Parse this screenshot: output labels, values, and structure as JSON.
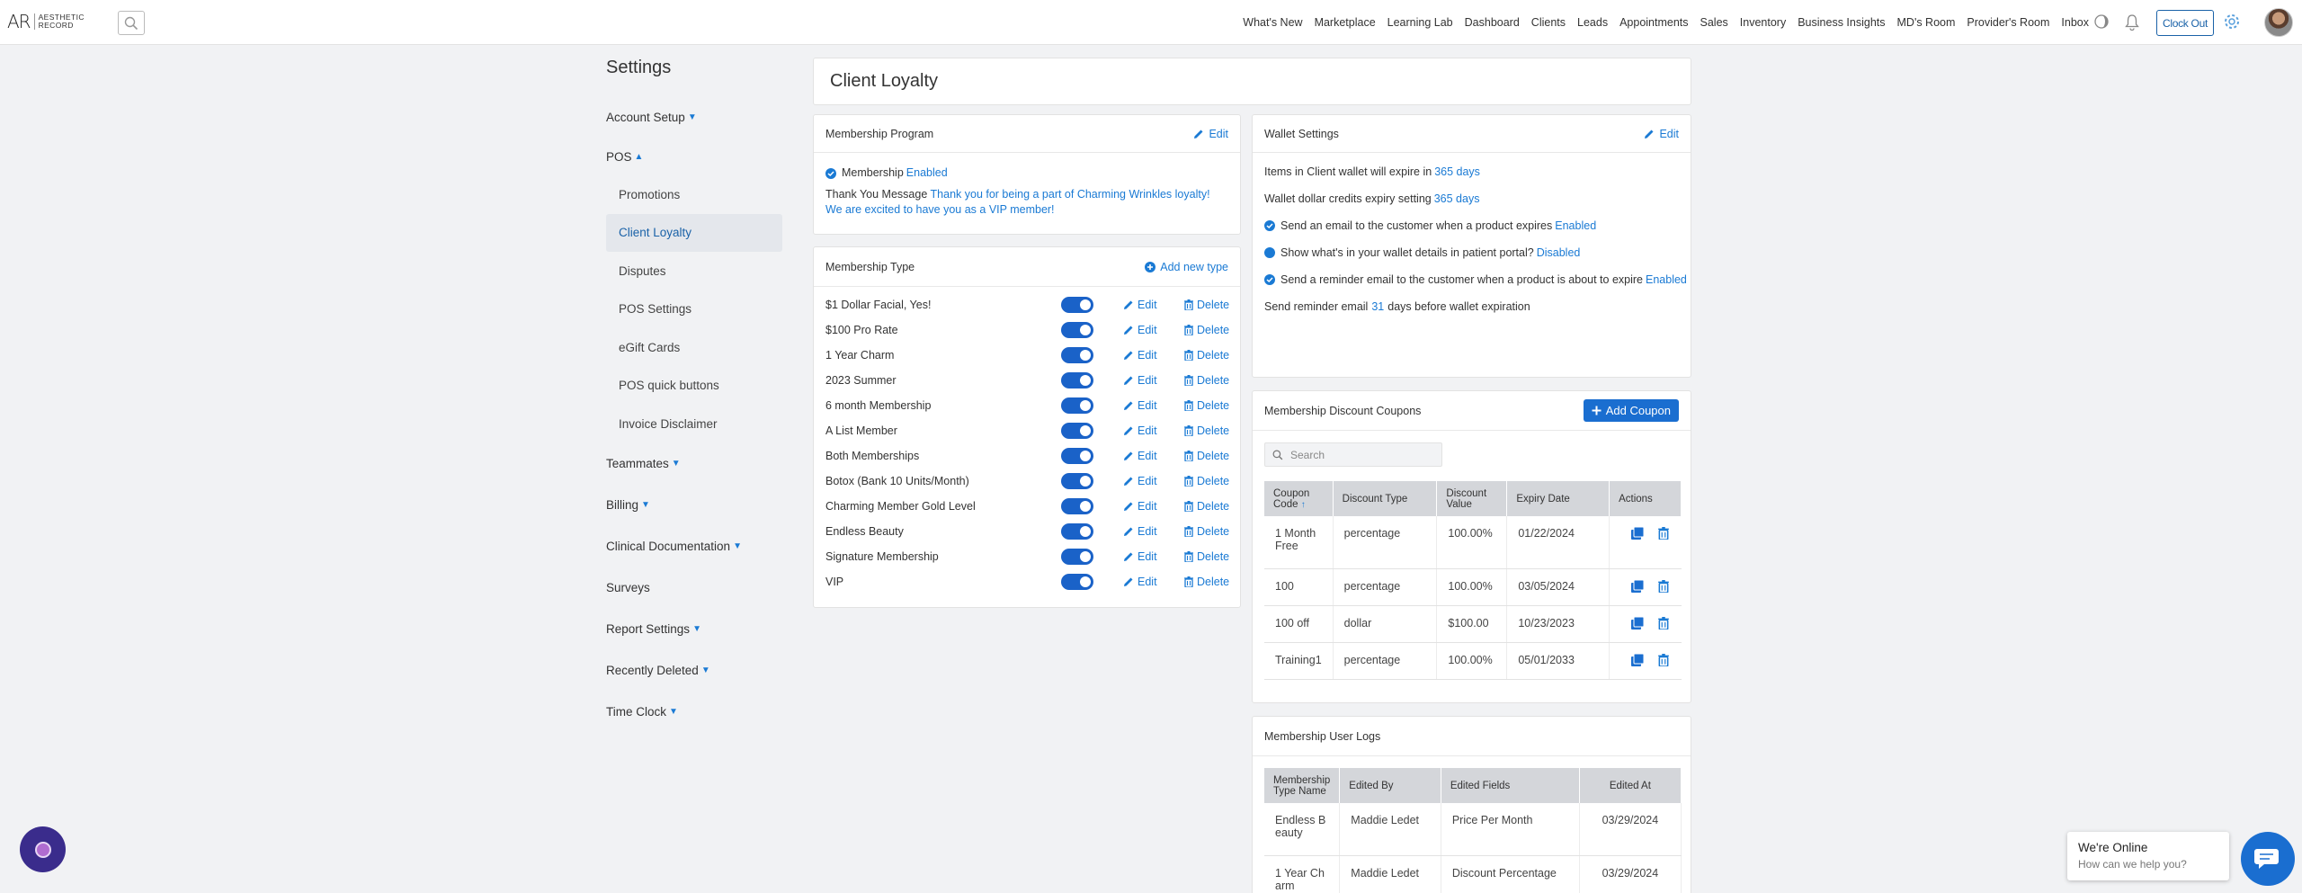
{
  "brand": {
    "mark": "AR",
    "name_line1": "AESTHETIC",
    "name_line2": "RECORD"
  },
  "nav": [
    "What's New",
    "Marketplace",
    "Learning Lab",
    "Dashboard",
    "Clients",
    "Leads",
    "Appointments",
    "Sales",
    "Inventory",
    "Business Insights",
    "MD's Room",
    "Provider's Room",
    "Inbox"
  ],
  "clock_out_label": "Clock Out",
  "sidebar": {
    "title": "Settings",
    "account_setup": "Account Setup",
    "pos": "POS",
    "pos_items": [
      "Promotions",
      "Client Loyalty",
      "Disputes",
      "POS Settings",
      "eGift Cards",
      "POS quick buttons",
      "Invoice Disclaimer"
    ],
    "teammates": "Teammates",
    "billing": "Billing",
    "clinical_documentation": "Clinical Documentation",
    "surveys": "Surveys",
    "report_settings": "Report Settings",
    "recently_deleted": "Recently Deleted",
    "time_clock": "Time Clock"
  },
  "page_title": "Client Loyalty",
  "membership_program": {
    "title": "Membership Program",
    "edit_label": "Edit",
    "membership_label": "Membership",
    "membership_status": "Enabled",
    "thank_you_label": "Thank You Message",
    "thank_you_text": "Thank you for being a part of Charming Wrinkles loyalty! We are excited to have you as a VIP member!"
  },
  "membership_type": {
    "title": "Membership Type",
    "add_label": "Add new type",
    "edit_label": "Edit",
    "delete_label": "Delete",
    "items": [
      "$1 Dollar Facial, Yes!",
      "$100 Pro Rate",
      "1 Year Charm",
      "2023 Summer",
      "6 month Membership",
      "A List Member",
      "Both Memberships",
      "Botox (Bank 10 Units/Month)",
      "Charming Member Gold Level",
      "Endless Beauty",
      "Signature Membership",
      "VIP"
    ]
  },
  "wallet": {
    "title": "Wallet Settings",
    "edit_label": "Edit",
    "items_expire_label": "Items in Client wallet will expire in",
    "items_expire_value": "365 days",
    "credits_label": "Wallet dollar credits expiry setting",
    "credits_value": "365 days",
    "email_expire_label": "Send an email to the customer when a product expires",
    "email_expire_value": "Enabled",
    "portal_label": "Show what's in your wallet details in patient portal?",
    "portal_value": "Disabled",
    "reminder_label": "Send a reminder email to the customer when a product is about to expire",
    "reminder_value": "Enabled",
    "reminder_days_prefix": "Send reminder email",
    "reminder_days_value": "31",
    "reminder_days_suffix": "days before wallet expiration"
  },
  "coupons": {
    "title": "Membership Discount Coupons",
    "add_label": "Add Coupon",
    "search_placeholder": "Search",
    "headers": {
      "code_1": "Coupon",
      "code_2": "Code",
      "type": "Discount Type",
      "value_1": "Discount",
      "value_2": "Value",
      "expiry": "Expiry Date",
      "actions": "Actions"
    },
    "rows": [
      {
        "code_1": "1 Month",
        "code_2": "Free",
        "type": "percentage",
        "value": "100.00%",
        "expiry": "01/22/2024"
      },
      {
        "code_1": "100",
        "code_2": "",
        "type": "percentage",
        "value": "100.00%",
        "expiry": "03/05/2024"
      },
      {
        "code_1": "100 off",
        "code_2": "",
        "type": "dollar",
        "value": "$100.00",
        "expiry": "10/23/2023"
      },
      {
        "code_1": "Training1",
        "code_2": "",
        "type": "percentage",
        "value": "100.00%",
        "expiry": "05/01/2033"
      }
    ]
  },
  "logs": {
    "title": "Membership User Logs",
    "headers": {
      "name_1": "Membership",
      "name_2": "Type Name",
      "by": "Edited By",
      "fields": "Edited Fields",
      "at": "Edited At"
    },
    "rows": [
      {
        "name_1": "Endless B",
        "name_2": "eauty",
        "by": "Maddie Ledet",
        "fields": "Price Per Month",
        "at": "03/29/2024"
      },
      {
        "name_1": "1 Year Ch",
        "name_2": "arm",
        "by": "Maddie Ledet",
        "fields": "Discount Percentage",
        "at": "03/29/2024"
      }
    ]
  },
  "chat": {
    "title": "We're Online",
    "subtitle": "How can we help you?"
  },
  "colors": {
    "accent": "#1a7ad4",
    "toggle": "#1a62c8",
    "support": "#3a2c8c"
  }
}
